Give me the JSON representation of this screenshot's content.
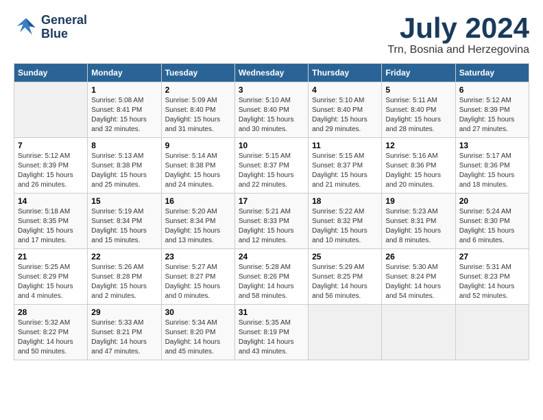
{
  "logo": {
    "line1": "General",
    "line2": "Blue"
  },
  "title": "July 2024",
  "location": "Trn, Bosnia and Herzegovina",
  "days_of_week": [
    "Sunday",
    "Monday",
    "Tuesday",
    "Wednesday",
    "Thursday",
    "Friday",
    "Saturday"
  ],
  "weeks": [
    [
      {
        "day": "",
        "sunrise": "",
        "sunset": "",
        "daylight": ""
      },
      {
        "day": "1",
        "sunrise": "Sunrise: 5:08 AM",
        "sunset": "Sunset: 8:41 PM",
        "daylight": "Daylight: 15 hours and 32 minutes."
      },
      {
        "day": "2",
        "sunrise": "Sunrise: 5:09 AM",
        "sunset": "Sunset: 8:40 PM",
        "daylight": "Daylight: 15 hours and 31 minutes."
      },
      {
        "day": "3",
        "sunrise": "Sunrise: 5:10 AM",
        "sunset": "Sunset: 8:40 PM",
        "daylight": "Daylight: 15 hours and 30 minutes."
      },
      {
        "day": "4",
        "sunrise": "Sunrise: 5:10 AM",
        "sunset": "Sunset: 8:40 PM",
        "daylight": "Daylight: 15 hours and 29 minutes."
      },
      {
        "day": "5",
        "sunrise": "Sunrise: 5:11 AM",
        "sunset": "Sunset: 8:40 PM",
        "daylight": "Daylight: 15 hours and 28 minutes."
      },
      {
        "day": "6",
        "sunrise": "Sunrise: 5:12 AM",
        "sunset": "Sunset: 8:39 PM",
        "daylight": "Daylight: 15 hours and 27 minutes."
      }
    ],
    [
      {
        "day": "7",
        "sunrise": "Sunrise: 5:12 AM",
        "sunset": "Sunset: 8:39 PM",
        "daylight": "Daylight: 15 hours and 26 minutes."
      },
      {
        "day": "8",
        "sunrise": "Sunrise: 5:13 AM",
        "sunset": "Sunset: 8:38 PM",
        "daylight": "Daylight: 15 hours and 25 minutes."
      },
      {
        "day": "9",
        "sunrise": "Sunrise: 5:14 AM",
        "sunset": "Sunset: 8:38 PM",
        "daylight": "Daylight: 15 hours and 24 minutes."
      },
      {
        "day": "10",
        "sunrise": "Sunrise: 5:15 AM",
        "sunset": "Sunset: 8:37 PM",
        "daylight": "Daylight: 15 hours and 22 minutes."
      },
      {
        "day": "11",
        "sunrise": "Sunrise: 5:15 AM",
        "sunset": "Sunset: 8:37 PM",
        "daylight": "Daylight: 15 hours and 21 minutes."
      },
      {
        "day": "12",
        "sunrise": "Sunrise: 5:16 AM",
        "sunset": "Sunset: 8:36 PM",
        "daylight": "Daylight: 15 hours and 20 minutes."
      },
      {
        "day": "13",
        "sunrise": "Sunrise: 5:17 AM",
        "sunset": "Sunset: 8:36 PM",
        "daylight": "Daylight: 15 hours and 18 minutes."
      }
    ],
    [
      {
        "day": "14",
        "sunrise": "Sunrise: 5:18 AM",
        "sunset": "Sunset: 8:35 PM",
        "daylight": "Daylight: 15 hours and 17 minutes."
      },
      {
        "day": "15",
        "sunrise": "Sunrise: 5:19 AM",
        "sunset": "Sunset: 8:34 PM",
        "daylight": "Daylight: 15 hours and 15 minutes."
      },
      {
        "day": "16",
        "sunrise": "Sunrise: 5:20 AM",
        "sunset": "Sunset: 8:34 PM",
        "daylight": "Daylight: 15 hours and 13 minutes."
      },
      {
        "day": "17",
        "sunrise": "Sunrise: 5:21 AM",
        "sunset": "Sunset: 8:33 PM",
        "daylight": "Daylight: 15 hours and 12 minutes."
      },
      {
        "day": "18",
        "sunrise": "Sunrise: 5:22 AM",
        "sunset": "Sunset: 8:32 PM",
        "daylight": "Daylight: 15 hours and 10 minutes."
      },
      {
        "day": "19",
        "sunrise": "Sunrise: 5:23 AM",
        "sunset": "Sunset: 8:31 PM",
        "daylight": "Daylight: 15 hours and 8 minutes."
      },
      {
        "day": "20",
        "sunrise": "Sunrise: 5:24 AM",
        "sunset": "Sunset: 8:30 PM",
        "daylight": "Daylight: 15 hours and 6 minutes."
      }
    ],
    [
      {
        "day": "21",
        "sunrise": "Sunrise: 5:25 AM",
        "sunset": "Sunset: 8:29 PM",
        "daylight": "Daylight: 15 hours and 4 minutes."
      },
      {
        "day": "22",
        "sunrise": "Sunrise: 5:26 AM",
        "sunset": "Sunset: 8:28 PM",
        "daylight": "Daylight: 15 hours and 2 minutes."
      },
      {
        "day": "23",
        "sunrise": "Sunrise: 5:27 AM",
        "sunset": "Sunset: 8:27 PM",
        "daylight": "Daylight: 15 hours and 0 minutes."
      },
      {
        "day": "24",
        "sunrise": "Sunrise: 5:28 AM",
        "sunset": "Sunset: 8:26 PM",
        "daylight": "Daylight: 14 hours and 58 minutes."
      },
      {
        "day": "25",
        "sunrise": "Sunrise: 5:29 AM",
        "sunset": "Sunset: 8:25 PM",
        "daylight": "Daylight: 14 hours and 56 minutes."
      },
      {
        "day": "26",
        "sunrise": "Sunrise: 5:30 AM",
        "sunset": "Sunset: 8:24 PM",
        "daylight": "Daylight: 14 hours and 54 minutes."
      },
      {
        "day": "27",
        "sunrise": "Sunrise: 5:31 AM",
        "sunset": "Sunset: 8:23 PM",
        "daylight": "Daylight: 14 hours and 52 minutes."
      }
    ],
    [
      {
        "day": "28",
        "sunrise": "Sunrise: 5:32 AM",
        "sunset": "Sunset: 8:22 PM",
        "daylight": "Daylight: 14 hours and 50 minutes."
      },
      {
        "day": "29",
        "sunrise": "Sunrise: 5:33 AM",
        "sunset": "Sunset: 8:21 PM",
        "daylight": "Daylight: 14 hours and 47 minutes."
      },
      {
        "day": "30",
        "sunrise": "Sunrise: 5:34 AM",
        "sunset": "Sunset: 8:20 PM",
        "daylight": "Daylight: 14 hours and 45 minutes."
      },
      {
        "day": "31",
        "sunrise": "Sunrise: 5:35 AM",
        "sunset": "Sunset: 8:19 PM",
        "daylight": "Daylight: 14 hours and 43 minutes."
      },
      {
        "day": "",
        "sunrise": "",
        "sunset": "",
        "daylight": ""
      },
      {
        "day": "",
        "sunrise": "",
        "sunset": "",
        "daylight": ""
      },
      {
        "day": "",
        "sunrise": "",
        "sunset": "",
        "daylight": ""
      }
    ]
  ]
}
